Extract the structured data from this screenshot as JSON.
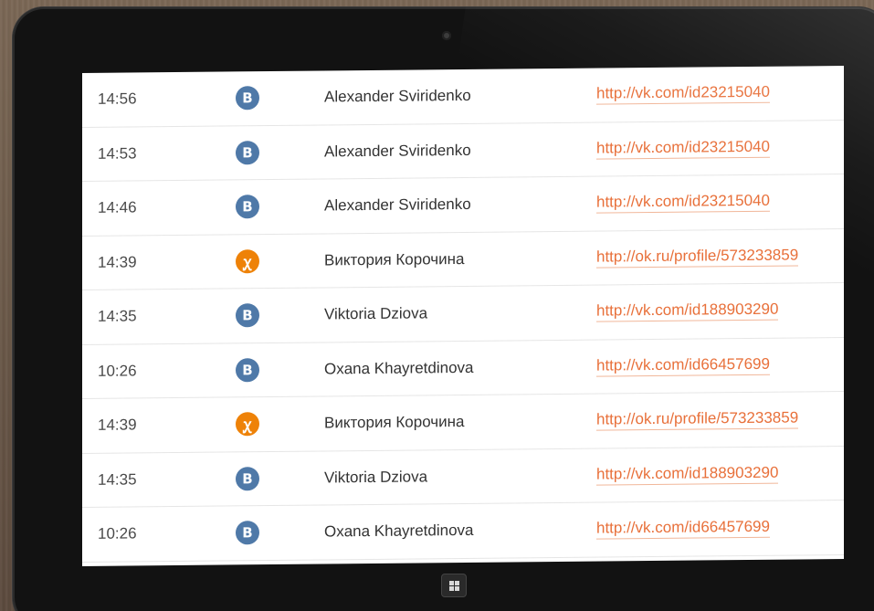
{
  "rows": [
    {
      "time": "14:56",
      "network": "vk",
      "network_icon": "vk-icon",
      "network_glyph": "B",
      "name": "Alexander Sviridenko",
      "link": "http://vk.com/id23215040"
    },
    {
      "time": "14:53",
      "network": "vk",
      "network_icon": "vk-icon",
      "network_glyph": "B",
      "name": "Alexander Sviridenko",
      "link": "http://vk.com/id23215040"
    },
    {
      "time": "14:46",
      "network": "vk",
      "network_icon": "vk-icon",
      "network_glyph": "B",
      "name": "Alexander Sviridenko",
      "link": "http://vk.com/id23215040"
    },
    {
      "time": "14:39",
      "network": "ok",
      "network_icon": "odnoklassniki-icon",
      "network_glyph": "ꭕ",
      "name": "Виктория Корочина",
      "link": "http://ok.ru/profile/573233859"
    },
    {
      "time": "14:35",
      "network": "vk",
      "network_icon": "vk-icon",
      "network_glyph": "B",
      "name": "Viktoria Dziova",
      "link": "http://vk.com/id188903290"
    },
    {
      "time": "10:26",
      "network": "vk",
      "network_icon": "vk-icon",
      "network_glyph": "B",
      "name": "Oxana Khayretdinova",
      "link": "http://vk.com/id66457699"
    },
    {
      "time": "14:39",
      "network": "ok",
      "network_icon": "odnoklassniki-icon",
      "network_glyph": "ꭕ",
      "name": "Виктория Корочина",
      "link": "http://ok.ru/profile/573233859"
    },
    {
      "time": "14:35",
      "network": "vk",
      "network_icon": "vk-icon",
      "network_glyph": "B",
      "name": "Viktoria Dziova",
      "link": "http://vk.com/id188903290"
    },
    {
      "time": "10:26",
      "network": "vk",
      "network_icon": "vk-icon",
      "network_glyph": "B",
      "name": "Oxana Khayretdinova",
      "link": "http://vk.com/id66457699"
    }
  ],
  "colors": {
    "vk": "#4f79a8",
    "ok": "#ee8208",
    "link": "#e8703a"
  }
}
